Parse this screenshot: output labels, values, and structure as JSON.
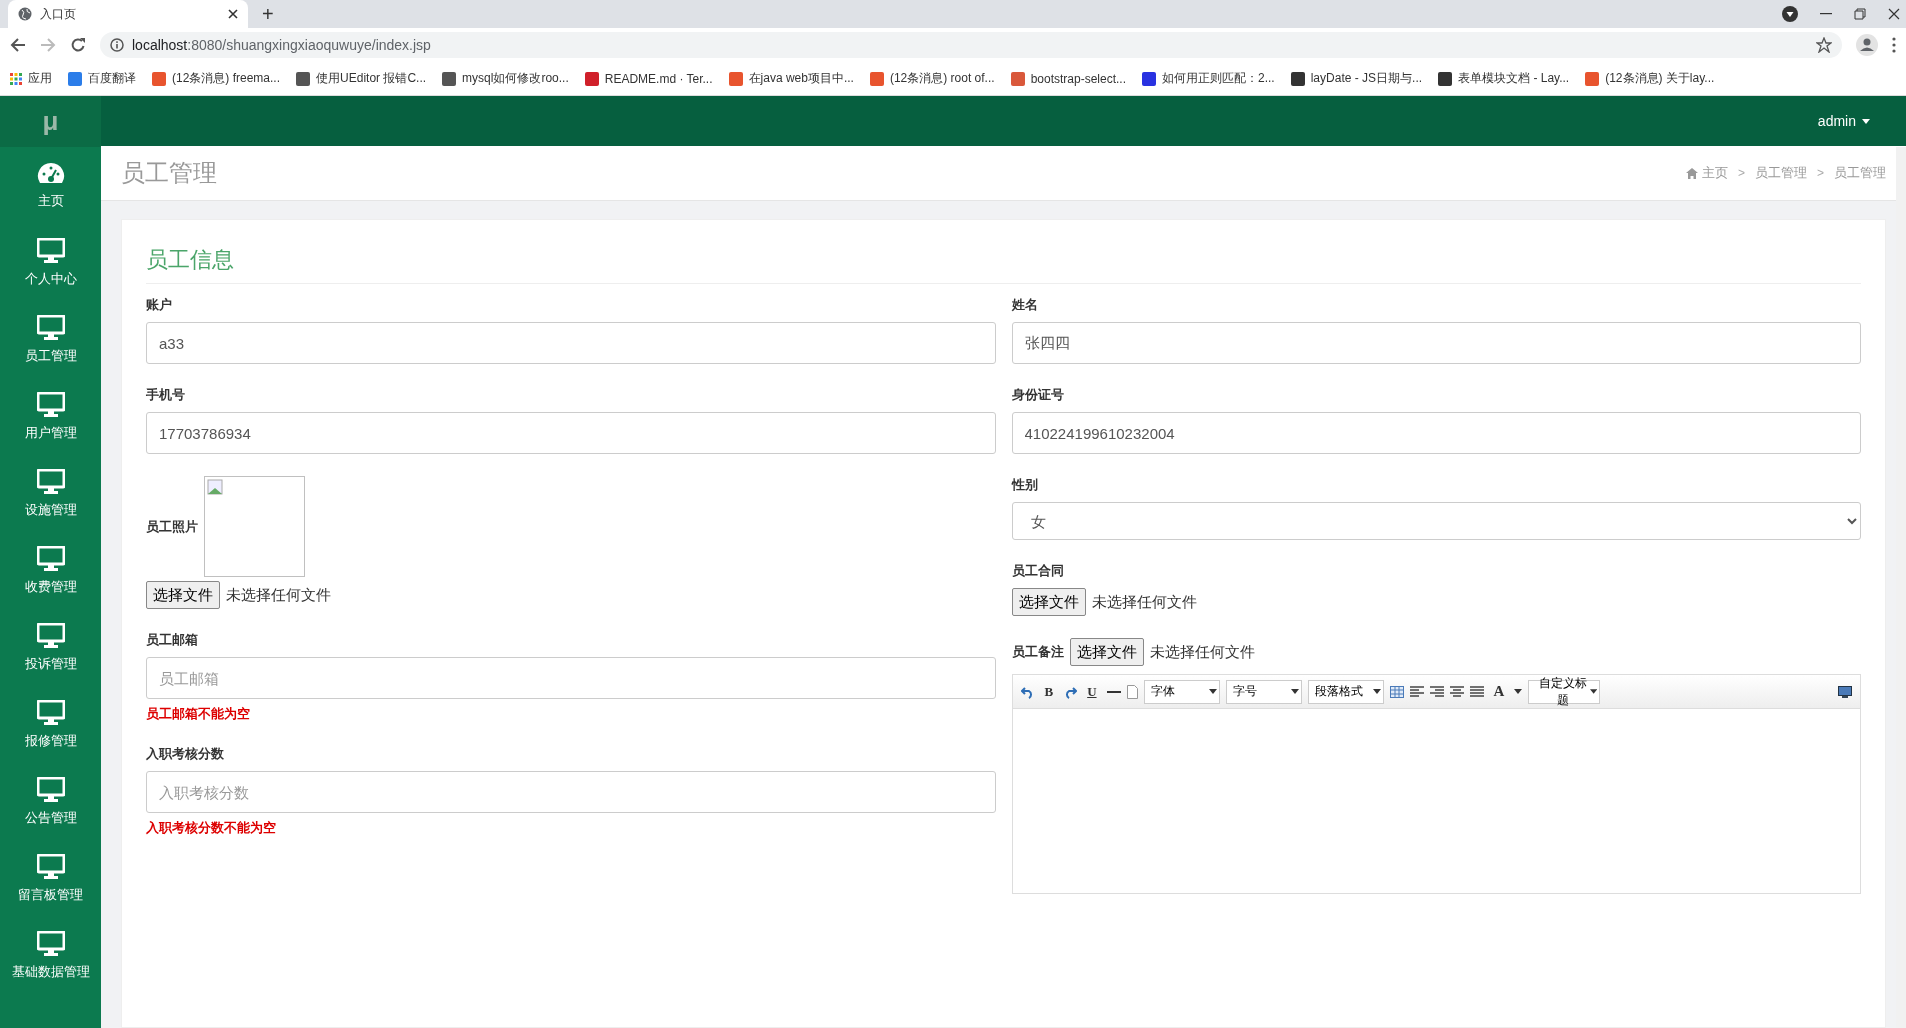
{
  "browser": {
    "tab_title": "入口页",
    "new_tab": "+",
    "url_host": "localhost",
    "url_path": ":8080/shuangxingxiaoquwuye/index.jsp",
    "apps_label": "应用",
    "bookmarks": [
      {
        "label": "百度翻译",
        "color": "#2b7de9"
      },
      {
        "label": "(12条消息) freema...",
        "color": "#e8542e"
      },
      {
        "label": "使用UEditor 报错C...",
        "color": "#555555"
      },
      {
        "label": "mysql如何修改roo...",
        "color": "#555555"
      },
      {
        "label": "README.md · Ter...",
        "color": "#d0202a"
      },
      {
        "label": "在java web项目中...",
        "color": "#e8542e"
      },
      {
        "label": "(12条消息) root of...",
        "color": "#e8542e"
      },
      {
        "label": "bootstrap-select...",
        "color": "#d9583b"
      },
      {
        "label": "如何用正则匹配：2...",
        "color": "#2932e1"
      },
      {
        "label": "layDate - JS日期与...",
        "color": "#333333"
      },
      {
        "label": "表单模块文档 - Lay...",
        "color": "#333333"
      },
      {
        "label": "(12条消息) 关于lay...",
        "color": "#e8542e"
      }
    ]
  },
  "topbar": {
    "logo": "μ",
    "user": "admin"
  },
  "sidebar": {
    "items": [
      {
        "label": "主页",
        "kind": "gauge"
      },
      {
        "label": "个人中心",
        "kind": "monitor"
      },
      {
        "label": "员工管理",
        "kind": "monitor"
      },
      {
        "label": "用户管理",
        "kind": "monitor"
      },
      {
        "label": "设施管理",
        "kind": "monitor"
      },
      {
        "label": "收费管理",
        "kind": "monitor"
      },
      {
        "label": "投诉管理",
        "kind": "monitor"
      },
      {
        "label": "报修管理",
        "kind": "monitor"
      },
      {
        "label": "公告管理",
        "kind": "monitor"
      },
      {
        "label": "留言板管理",
        "kind": "monitor"
      },
      {
        "label": "基础数据管理",
        "kind": "monitor"
      }
    ]
  },
  "page": {
    "title": "员工管理",
    "breadcrumb": [
      "主页",
      "员工管理",
      "员工管理"
    ],
    "separator": ">"
  },
  "form": {
    "title": "员工信息",
    "left": [
      {
        "kind": "text",
        "label": "账户",
        "value": "a33"
      },
      {
        "kind": "text",
        "label": "手机号",
        "value": "17703786934"
      },
      {
        "kind": "photo",
        "label": "员工照片",
        "button": "选择文件",
        "file_status": "未选择任何文件"
      },
      {
        "kind": "text",
        "label": "员工邮箱",
        "placeholder": "员工邮箱",
        "error": "员工邮箱不能为空"
      },
      {
        "kind": "text",
        "label": "入职考核分数",
        "placeholder": "入职考核分数",
        "error": "入职考核分数不能为空"
      }
    ],
    "right": [
      {
        "kind": "text",
        "label": "姓名",
        "value": "张四四"
      },
      {
        "kind": "text",
        "label": "身份证号",
        "value": "410224199610232004"
      },
      {
        "kind": "select",
        "label": "性别",
        "value": "女"
      },
      {
        "kind": "file",
        "label": "员工合同",
        "button": "选择文件",
        "file_status": "未选择任何文件"
      },
      {
        "kind": "editor",
        "label": "员工备注",
        "button": "选择文件",
        "file_status": "未选择任何文件",
        "toolbar": {
          "bold": "B",
          "underline": "U",
          "font_color": "A",
          "selects": [
            "字体",
            "字号",
            "段落格式"
          ],
          "heading_select": "自定义标题"
        }
      }
    ]
  }
}
